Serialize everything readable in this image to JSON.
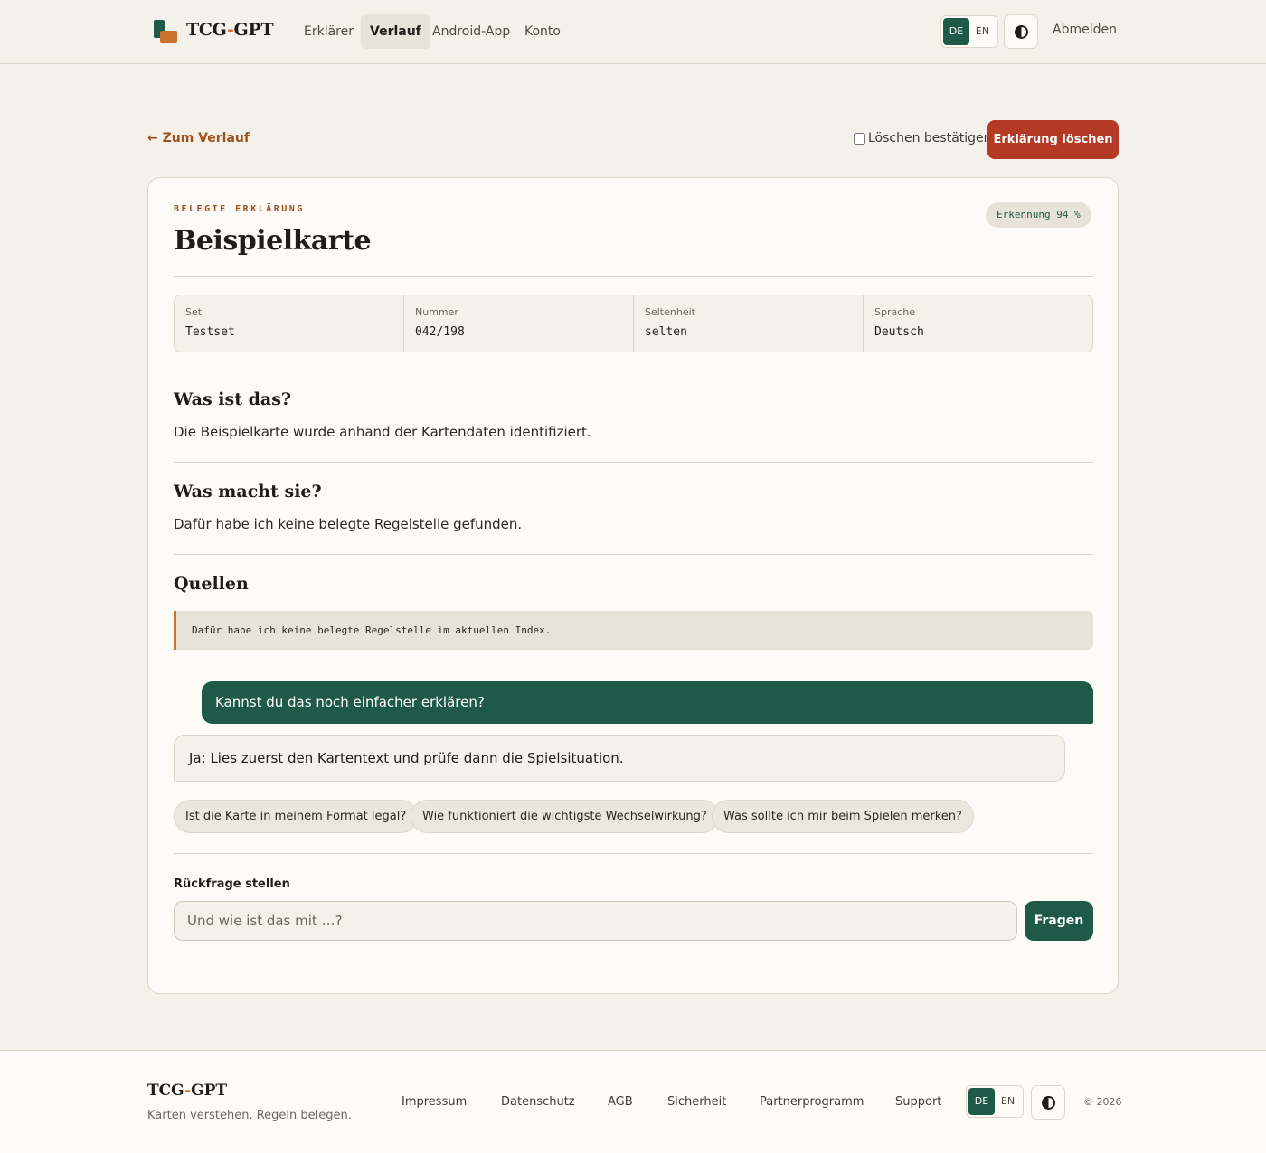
{
  "header": {
    "brand_left": "TCG",
    "brand_dash": "-",
    "brand_right": "GPT",
    "nav": [
      "Erklärer",
      "Verlauf",
      "Android-App",
      "Konto"
    ],
    "active_nav": "Verlauf",
    "lang": [
      "DE",
      "EN"
    ],
    "logout": "Abmelden"
  },
  "actions": {
    "back": "← Zum Verlauf",
    "confirm": "Löschen bestätigen",
    "delete": "Erklärung löschen"
  },
  "card": {
    "eyebrow": "BELEGTE ERKLÄRUNG",
    "title": "Beispielkarte",
    "badge": "Erkennung 94 %",
    "meta": [
      {
        "label": "Set",
        "value": "Testset"
      },
      {
        "label": "Nummer",
        "value": "042/198"
      },
      {
        "label": "Seltenheit",
        "value": "selten"
      },
      {
        "label": "Sprache",
        "value": "Deutsch"
      }
    ],
    "sections": [
      {
        "heading": "Was ist das?",
        "text": "Die Beispielkarte wurde anhand der Kartendaten identifiziert."
      },
      {
        "heading": "Was macht sie?",
        "text": "Dafür habe ich keine belegte Regelstelle gefunden."
      }
    ],
    "sources_heading": "Quellen",
    "source_text": "Dafür habe ich keine belegte Regelstelle im aktuellen Index.",
    "chat": {
      "user": "Kannst du das noch einfacher erklären?",
      "assistant": "Ja: Lies zuerst den Kartentext und prüfe dann die Spielsituation."
    },
    "suggestions": [
      "Ist die Karte in meinem Format legal?",
      "Wie funktioniert die wichtigste Wechselwirkung?",
      "Was sollte ich mir beim Spielen merken?"
    ],
    "ask": {
      "label": "Rückfrage stellen",
      "placeholder": "Und wie ist das mit …?",
      "button": "Fragen"
    }
  },
  "footer": {
    "brand_left": "TCG",
    "brand_dash": "-",
    "brand_right": "GPT",
    "tagline": "Karten verstehen. Regeln belegen.",
    "links": [
      "Impressum",
      "Datenschutz",
      "AGB",
      "Sicherheit",
      "Partnerprogramm",
      "Support"
    ],
    "lang": [
      "DE",
      "EN"
    ],
    "copyright": "© 2026"
  },
  "colors": {
    "accent_green": "#1f5a48",
    "accent_orange": "#c8722c",
    "danger": "#b43a25",
    "background": "#f4f1ea"
  },
  "icons": [
    "logo-icon",
    "theme-toggle-icon",
    "arrow-left-icon"
  ]
}
